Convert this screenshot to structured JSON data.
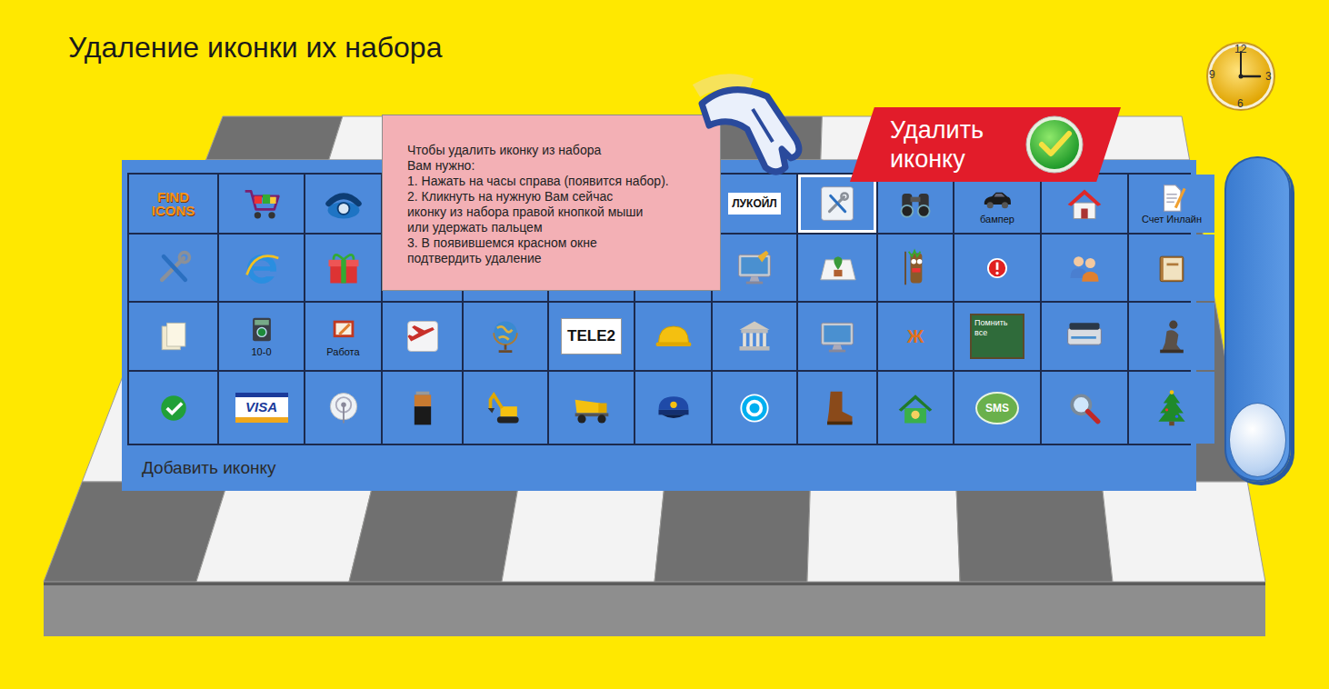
{
  "title": "Удаление иконки их набора",
  "clock": {
    "numerals": [
      "12",
      "3",
      "6",
      "9"
    ],
    "hour": 3,
    "minute": 0
  },
  "tooltip": {
    "lines": [
      "Чтобы удалить иконку из набора",
      "Вам нужно:",
      "1. Нажать на часы справа (появится набор).",
      "2. Кликнуть на нужную Вам сейчас",
      "иконку из набора правой кнопкой мыши",
      "или удержать пальцем",
      "3. В появившемся красном окне",
      "подтвердить удаление"
    ]
  },
  "delete_banner": {
    "label": "Удалить иконку"
  },
  "icon_grid": {
    "rows": [
      [
        {
          "logo": "FIND ICONS",
          "selected": false
        },
        {
          "selected": false
        },
        {
          "selected": false
        },
        {
          "selected": false
        },
        {
          "selected": false
        },
        {
          "selected": false
        },
        {
          "selected": false
        },
        {
          "logo": "ЛУКОЙЛ",
          "selected": false
        },
        {
          "selected": true
        },
        {
          "selected": false
        },
        {
          "caption": "бампер",
          "selected": false
        },
        {
          "selected": false
        },
        {
          "caption": "Счет Инлайн",
          "selected": false
        }
      ],
      [
        {
          "selected": false
        },
        {
          "selected": false
        },
        {
          "selected": false
        },
        {
          "selected": false
        },
        {
          "selected": false
        },
        {
          "selected": false
        },
        {
          "selected": false
        },
        {
          "selected": false
        },
        {
          "selected": false
        },
        {
          "selected": false
        },
        {
          "selected": false
        },
        {
          "selected": false
        },
        {
          "selected": false
        }
      ],
      [
        {
          "selected": false
        },
        {
          "caption": "10-0",
          "selected": false
        },
        {
          "caption": "Работа",
          "selected": false
        },
        {
          "selected": false
        },
        {
          "selected": false
        },
        {
          "logo": "TELE2",
          "selected": false
        },
        {
          "selected": false
        },
        {
          "selected": false
        },
        {
          "selected": false
        },
        {
          "logo": "Ж",
          "selected": false
        },
        {
          "logo": "Помнить все",
          "selected": false
        },
        {
          "selected": false
        },
        {
          "selected": false
        }
      ],
      [
        {
          "selected": false
        },
        {
          "logo": "VISA",
          "selected": false
        },
        {
          "selected": false
        },
        {
          "selected": false
        },
        {
          "selected": false
        },
        {
          "selected": false
        },
        {
          "selected": false
        },
        {
          "selected": false
        },
        {
          "selected": false
        },
        {
          "selected": false
        },
        {
          "logo": "SMS",
          "selected": false
        },
        {
          "selected": false
        },
        {
          "selected": false
        }
      ]
    ]
  },
  "add_button": {
    "label": "Добавить иконку"
  },
  "scrollbar": {
    "level": 1
  }
}
